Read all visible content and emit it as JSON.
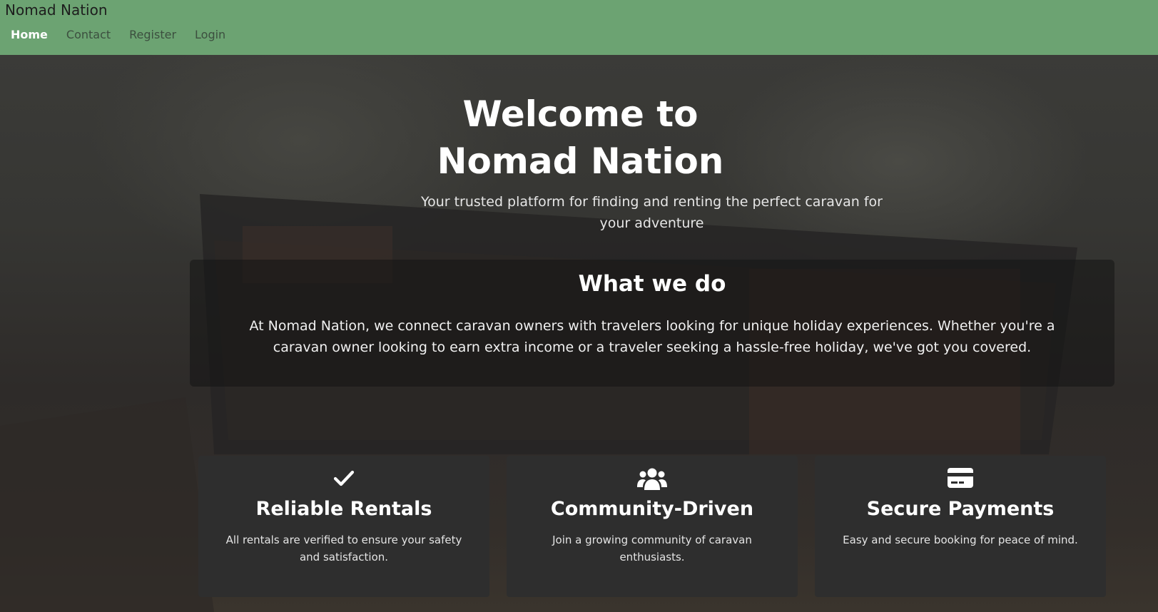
{
  "brand": "Nomad Nation",
  "nav": {
    "items": [
      {
        "label": "Home",
        "active": true
      },
      {
        "label": "Contact",
        "active": false
      },
      {
        "label": "Register",
        "active": false
      },
      {
        "label": "Login",
        "active": false
      }
    ]
  },
  "hero": {
    "title": "Welcome to Nomad Nation",
    "subtitle": "Your trusted platform for finding and renting the perfect caravan for your adventure"
  },
  "about": {
    "title": "What we do",
    "text": "At Nomad Nation, we connect caravan owners with travelers looking for unique holiday experiences. Whether you're a caravan owner looking to earn extra income or a traveler seeking a hassle-free holiday, we've got you covered."
  },
  "features": [
    {
      "icon": "checkmark-icon",
      "title": "Reliable Rentals",
      "text": "All rentals are verified to ensure your safety and satisfaction."
    },
    {
      "icon": "users-icon",
      "title": "Community-Driven",
      "text": "Join a growing community of caravan enthusiasts."
    },
    {
      "icon": "credit-card-icon",
      "title": "Secure Payments",
      "text": "Easy and secure booking for peace of mind."
    }
  ],
  "colors": {
    "navbar": "#6ca372",
    "card": "#2e2e2e",
    "text_light": "#ffffff"
  }
}
